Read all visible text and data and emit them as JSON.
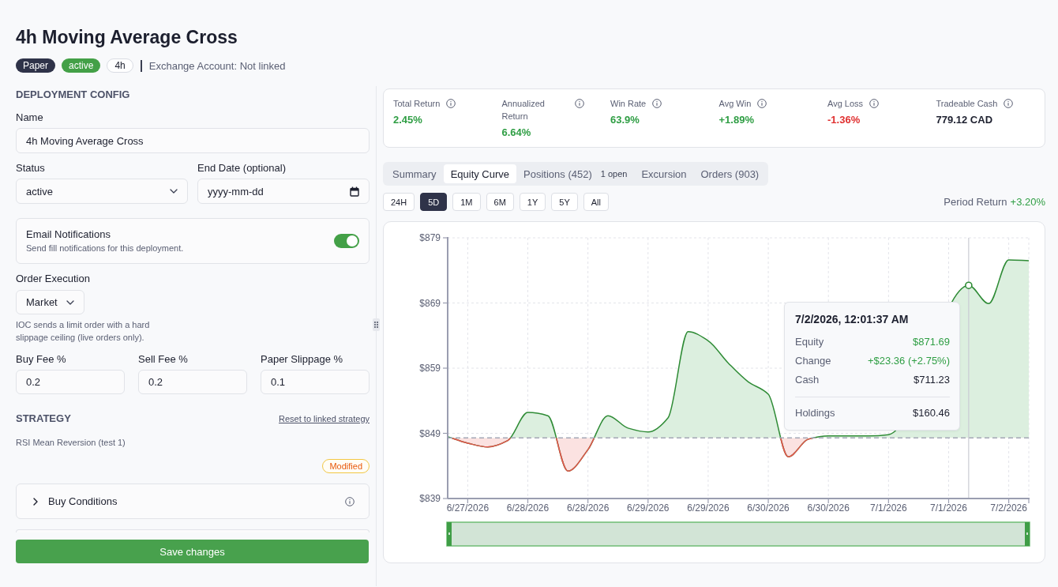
{
  "header": {
    "title": "4h Moving Average Cross",
    "badges": [
      {
        "label": "Paper",
        "kind": "mode"
      },
      {
        "label": "active",
        "kind": "status"
      },
      {
        "label": "4h",
        "kind": "interval"
      }
    ],
    "exchange_account": "Exchange Account: Not linked"
  },
  "config": {
    "heading": "DEPLOYMENT CONFIG",
    "name": {
      "label": "Name",
      "value": "4h Moving Average Cross"
    },
    "status": {
      "label": "Status",
      "value": "active"
    },
    "end_date": {
      "label": "End Date (optional)",
      "placeholder": "yyyy-mm-dd"
    },
    "email_notifications": {
      "title": "Email Notifications",
      "description": "Send fill notifications for this deployment.",
      "on": true
    },
    "order_execution": {
      "label": "Order Execution",
      "value": "Market",
      "help": "IOC sends a limit order with a hard slippage ceiling (live orders only)."
    },
    "fees": [
      {
        "label": "Buy Fee %",
        "value": "0.2"
      },
      {
        "label": "Sell Fee %",
        "value": "0.2"
      },
      {
        "label": "Paper Slippage %",
        "value": "0.1"
      }
    ]
  },
  "strategy": {
    "heading": "STRATEGY",
    "reset_link": "Reset to linked strategy",
    "name": "RSI Mean Reversion (test 1)",
    "modified_badge": "Modified",
    "sections": [
      {
        "title": "Buy Conditions",
        "expanded": false
      }
    ]
  },
  "save_button": "Save changes",
  "metrics": [
    {
      "label": "Total Return",
      "value": "2.45%",
      "color": "#2f9e44"
    },
    {
      "label": "Annualized Return",
      "value": "6.64%",
      "color": "#2f9e44"
    },
    {
      "label": "Win Rate",
      "value": "63.9%",
      "color": "#2f9e44"
    },
    {
      "label": "Avg Win",
      "value": "+1.89%",
      "color": "#2f9e44"
    },
    {
      "label": "Avg Loss",
      "value": "-1.36%",
      "color": "#e03131"
    },
    {
      "label": "Tradeable Cash",
      "value": "779.12 CAD",
      "color": "#1c1f2e"
    }
  ],
  "tabs": [
    {
      "label": "Summary",
      "selected": false
    },
    {
      "label": "Equity Curve",
      "selected": true
    },
    {
      "label": "Positions (452)",
      "badge": "1 open",
      "selected": false
    },
    {
      "label": "Excursion",
      "selected": false
    },
    {
      "label": "Orders (903)",
      "selected": false
    }
  ],
  "ranges": [
    {
      "label": "24H",
      "selected": false
    },
    {
      "label": "5D",
      "selected": true
    },
    {
      "label": "1M",
      "selected": false
    },
    {
      "label": "6M",
      "selected": false
    },
    {
      "label": "1Y",
      "selected": false
    },
    {
      "label": "5Y",
      "selected": false
    },
    {
      "label": "All",
      "selected": false
    }
  ],
  "period_return": {
    "label": "Period Return",
    "value": "+3.20%",
    "color": "#2f9e44"
  },
  "equity_chart": {
    "chart_data": {
      "type": "area",
      "grid": true,
      "categories": [
        null,
        "6/27/2026",
        null,
        null,
        "6/28/2026",
        null,
        null,
        "6/28/2026",
        null,
        null,
        "6/29/2026",
        null,
        null,
        "6/29/2026",
        null,
        null,
        "6/30/2026",
        null,
        null,
        "6/30/2026",
        null,
        null,
        "7/1/2026",
        null,
        null,
        "7/1/2026",
        null,
        null,
        "7/2/2026",
        null
      ],
      "ylim": [
        839,
        879
      ],
      "yticks": [
        {
          "value": 879,
          "label": "$879"
        },
        {
          "value": 869,
          "label": "$869"
        },
        {
          "value": 859,
          "label": "$859"
        },
        {
          "value": 849,
          "label": "$849"
        },
        {
          "value": 839,
          "label": "$839"
        }
      ],
      "series": [
        {
          "color": "#2e8b35",
          "values": [
            848.5,
            847.5,
            846.9,
            847.9,
            852.2,
            851.7,
            843.2,
            846.5,
            851.7,
            849.8,
            849.2,
            851.4,
            864.6,
            863.2,
            859.8,
            856.9,
            855.0,
            845.4,
            848.1,
            848.6,
            null,
            848.6,
            848.8,
            null,
            null,
            null,
            871.7,
            868.9,
            875.6,
            875.5
          ]
        }
      ],
      "ref_lines": [
        {
          "axis": "y",
          "value": 848.3
        }
      ]
    },
    "tooltip": {
      "title": "7/2/2026, 12:01:37 AM",
      "rows": [
        {
          "label": "Equity",
          "value": "$871.69",
          "color": "#2f9e44"
        },
        {
          "label": "Change",
          "value": "+$23.36 (+2.75%)",
          "color": "#2f9e44"
        },
        {
          "label": "Cash",
          "value": "$711.23",
          "color": "#1c1f2e"
        }
      ],
      "footer_rows": [
        {
          "label": "Holdings",
          "value": "$160.46",
          "color": "#1c1f2e"
        }
      ]
    }
  }
}
